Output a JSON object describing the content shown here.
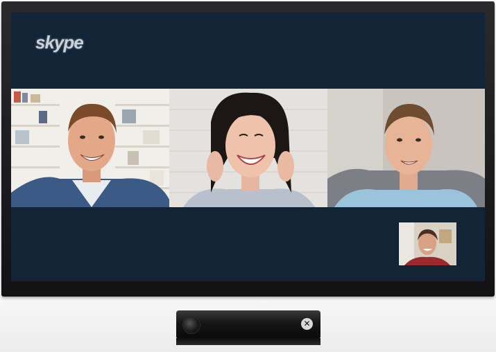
{
  "app": {
    "brand": "skype"
  },
  "call": {
    "participants": [
      {
        "name": "",
        "scene": "bookshelf"
      },
      {
        "name": "",
        "scene": "white-wall"
      },
      {
        "name": "",
        "scene": "living-room"
      }
    ],
    "self_view": {
      "label": ""
    }
  },
  "colors": {
    "screen_bg": "#132437",
    "tv_bezel": "#1c1c1e"
  },
  "icons": {
    "sensor_logo": "xbox-logo-icon",
    "sensor_camera": "camera-lens-icon"
  }
}
